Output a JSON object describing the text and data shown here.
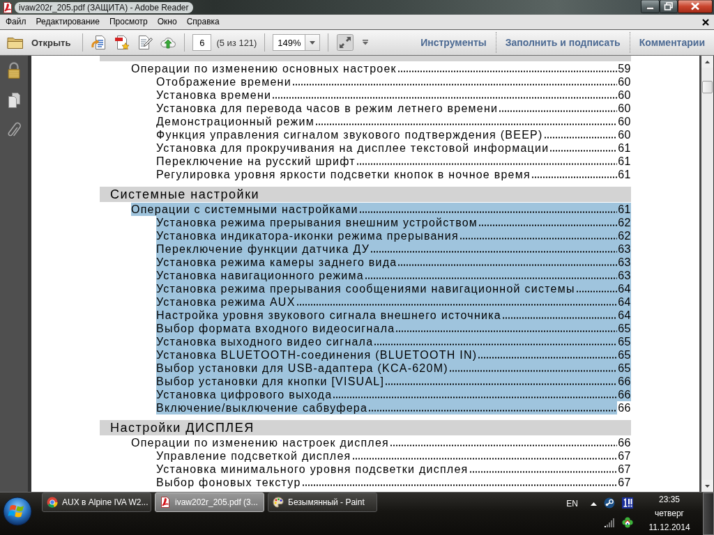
{
  "window": {
    "title": "ivaw202r_205.pdf (ЗАЩИТА) - Adobe Reader"
  },
  "menu": {
    "items": [
      "Файл",
      "Редактирование",
      "Просмотр",
      "Окно",
      "Справка"
    ]
  },
  "toolbar": {
    "open_button": "Открыть",
    "page_field": {
      "value": "6"
    },
    "page_count": "(5 из 121)",
    "zoom_field": {
      "value": "149%"
    },
    "panels": [
      "Инструменты",
      "Заполнить и подписать",
      "Комментарии"
    ]
  },
  "document": {
    "sections": [
      {
        "entries": [
          {
            "title": "Операции по изменению основных настроек",
            "page": "59",
            "selected": false,
            "children": [
              {
                "title": "Отображение времени",
                "page": "60",
                "selected": false
              },
              {
                "title": "Установка времени",
                "page": "60",
                "selected": false
              },
              {
                "title": "Установка для перевода часов в режим летнего времени",
                "page": "60",
                "selected": false
              },
              {
                "title": "Демонстрационный режим",
                "page": "60",
                "selected": false
              },
              {
                "title": "Функция управления сигналом звукового подтверждения (BEEP)",
                "page": "60",
                "selected": false
              },
              {
                "title": "Установка для прокручивания на дисплее текстовой информации",
                "page": "61",
                "selected": false
              },
              {
                "title": "Переключение на русский шрифт",
                "page": "61",
                "selected": false
              },
              {
                "title": "Регулировка уровня яркости подсветки кнопок в ночное время",
                "page": "61",
                "selected": false
              }
            ]
          }
        ]
      },
      {
        "heading": "Системные настройки",
        "entries": [
          {
            "title": "Операции с системными настройками",
            "page": "61",
            "selected": true,
            "children": [
              {
                "title": "Установка режима прерывания внешним устройством",
                "page": "62",
                "selected": true
              },
              {
                "title": "Установка индикатора-иконки режима прерывания",
                "page": "62",
                "selected": true
              },
              {
                "title": "Переключение функции датчика ДУ",
                "page": "63",
                "selected": true
              },
              {
                "title": "Установка режима камеры заднего вида",
                "page": "63",
                "selected": true
              },
              {
                "title": "Установка навигационного режима",
                "page": "63",
                "selected": true
              },
              {
                "title": "Установка режима прерывания сообщениями навигационной системы",
                "page": "64",
                "selected": true
              },
              {
                "title": "Установка режима AUX",
                "page": "64",
                "selected": true
              },
              {
                "title": "Настройка уровня звукового сигнала внешнего источника",
                "page": "64",
                "selected": true
              },
              {
                "title": "Выбор формата входного видеосигнала",
                "page": "65",
                "selected": true
              },
              {
                "title": "Установка выходного видео сигнала",
                "page": "65",
                "selected": true
              },
              {
                "title": "Установка BLUETOOTH-соединения (BLUETOOTH IN)",
                "page": "65",
                "selected": true
              },
              {
                "title": "Выбор установки для USB-адаптера (KCA-620M)",
                "page": "65",
                "selected": true
              },
              {
                "title": "Выбор установки для кнопки [VISUAL]",
                "page": "66",
                "selected": true
              },
              {
                "title": "Установка цифрового выхода",
                "page": "66",
                "selected": true
              },
              {
                "title": "Включение/выключение сабвуфера",
                "page": "66",
                "selected": true
              }
            ]
          }
        ]
      },
      {
        "heading": "Настройки ДИСПЛЕЯ",
        "entries": [
          {
            "title": "Операции по изменению настроек дисплея",
            "page": "66",
            "selected": false,
            "children": [
              {
                "title": "Управление подсветкой дисплея",
                "page": "67",
                "selected": false
              },
              {
                "title": "Установка минимального уровня подсветки дисплея",
                "page": "67",
                "selected": false
              },
              {
                "title": "Выбор фоновых текстур",
                "page": "67",
                "selected": false
              }
            ]
          }
        ]
      }
    ]
  },
  "taskbar": {
    "buttons": [
      {
        "kind": "browser",
        "label": "AUX в Alpine IVA W2...",
        "selected": false
      },
      {
        "kind": "pdf",
        "label": "ivaw202r_205.pdf (3...",
        "selected": true
      },
      {
        "kind": "paint",
        "label": "Безымянный - Paint",
        "selected": false
      }
    ],
    "language": "EN",
    "clock": {
      "time": "23:35",
      "weekday": "четверг",
      "date": "11.12.2014"
    }
  }
}
